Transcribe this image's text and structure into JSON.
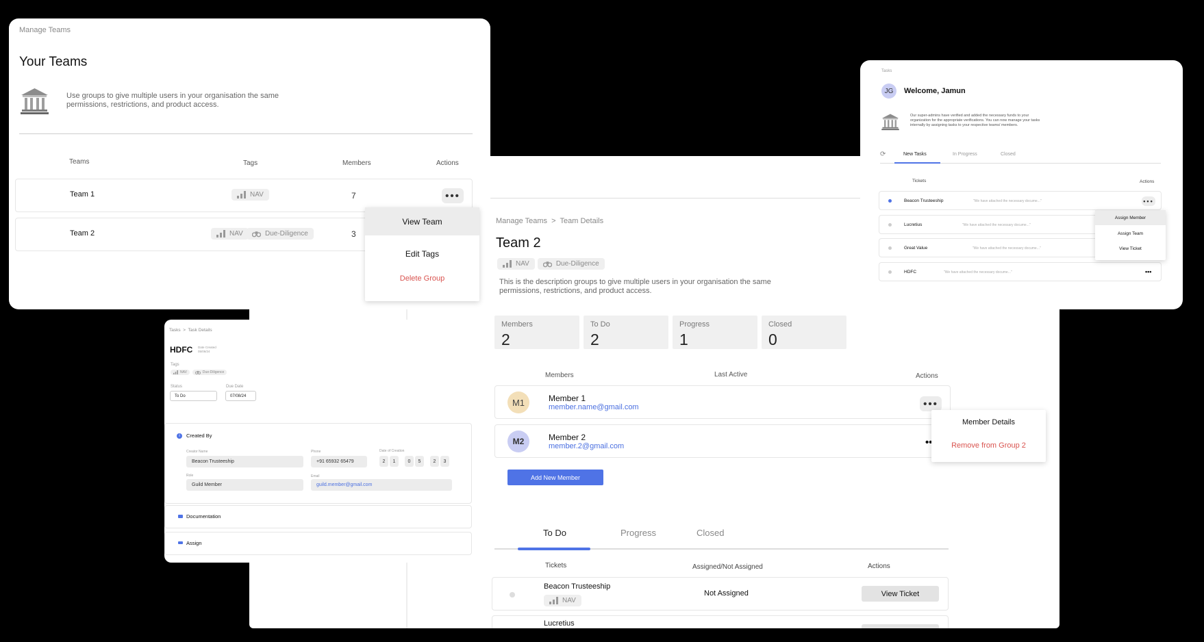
{
  "teams_card": {
    "breadcrumb": "Manage Teams",
    "title": "Your Teams",
    "description": "Use groups to give multiple users in your organisation the same permissions, restrictions, and product access.",
    "columns": [
      "Teams",
      "Tags",
      "Members",
      "Actions"
    ],
    "rows": [
      {
        "name": "Team 1",
        "tags": [
          "NAV"
        ],
        "members": "7"
      },
      {
        "name": "Team 2",
        "tags": [
          "NAV",
          "Due-Diligence"
        ],
        "members": "3"
      }
    ],
    "menu": [
      "View Team",
      "Edit Tags",
      "Delete Group"
    ]
  },
  "team_details": {
    "breadcrumb_root": "Manage Teams",
    "breadcrumb_sep": ">",
    "breadcrumb_current": "Team Details",
    "title": "Team 2",
    "tags": [
      "NAV",
      "Due-Diligence"
    ],
    "description": "This is the description groups to give multiple users in your organisation the same permissions, restrictions, and product access.",
    "stats": [
      {
        "label": "Members",
        "value": "2"
      },
      {
        "label": "To Do",
        "value": "2"
      },
      {
        "label": "Progress",
        "value": "1"
      },
      {
        "label": "Closed",
        "value": "0"
      }
    ],
    "member_columns": [
      "Members",
      "Last Active",
      "Actions"
    ],
    "members": [
      {
        "initials": "M1",
        "name": "Member 1",
        "email": "member.name@gmail.com",
        "avatar_color": "#f3dfb8"
      },
      {
        "initials": "M2",
        "name": "Member 2",
        "email": "member.2@gmail.com",
        "avatar_color": "#c9cdf3"
      }
    ],
    "member_menu": [
      "Member Details",
      "Remove from Group 2"
    ],
    "add_member": "Add New Member",
    "tabs": [
      "To Do",
      "Progress",
      "Closed"
    ],
    "ticket_columns": [
      "Tickets",
      "Assigned/Not Assigned",
      "Actions"
    ],
    "tickets": [
      {
        "name": "Beacon Trusteeship",
        "tag": "NAV",
        "status": "Not Assigned",
        "action": "View Ticket"
      },
      {
        "name": "Lucretius"
      }
    ]
  },
  "tasks_card": {
    "breadcrumb": "Tasks",
    "avatar": "JG",
    "welcome": "Welcome, Jamun",
    "description": "Our super-admins have verified and added the necessary funds to your organization for the appropriate verifications. You can now manage your tasks internally by assigning tasks to your respective teams/ members.",
    "tabs": [
      "New Tasks",
      "In Progress",
      "Closed"
    ],
    "columns": [
      "Tickets",
      "Actions"
    ],
    "rows": [
      {
        "name": "Beacon Trusteeship",
        "note": "\"We have attached the necessary docume...\""
      },
      {
        "name": "Lucretius",
        "note": "\"We have attached the necessary docume...\""
      },
      {
        "name": "Great Value",
        "note": "\"We have attached the necessary docume...\""
      },
      {
        "name": "HDFC",
        "note": "\"We have attached the necessary docume...\""
      }
    ],
    "menu": [
      "Assign Member",
      "Assign Team",
      "View Ticket"
    ]
  },
  "task_details": {
    "breadcrumb_root": "Tasks",
    "breadcrumb_sep": ">",
    "breadcrumb_current": "Task Details",
    "title": "HDFC",
    "subtitle_1": "Date Created",
    "subtitle_2": "05/06/24",
    "tags_label": "Tags",
    "tags": [
      "NAV",
      "Due-Diligence"
    ],
    "status_label": "Status",
    "status_value": "To Do",
    "due_label": "Due Date",
    "due_value": "07/08/24",
    "created_by": "Created By",
    "creator_name_label": "Creator Name",
    "creator_name": "Beacon Trusteeship",
    "phone_label": "Phone",
    "phone": "+91 65932 65479",
    "date_label": "Date of Creation",
    "date_digits": [
      "2",
      "1",
      "0",
      "5",
      "2",
      "3"
    ],
    "role_label": "Role",
    "role": "Guild Member",
    "email_label": "Email",
    "email": "guild.member@gmail.com",
    "documentation": "Documentation",
    "assign": "Assign"
  },
  "colors": {
    "accent": "#4f73e6",
    "danger": "#d9534f",
    "link": "#4a6fe0"
  }
}
